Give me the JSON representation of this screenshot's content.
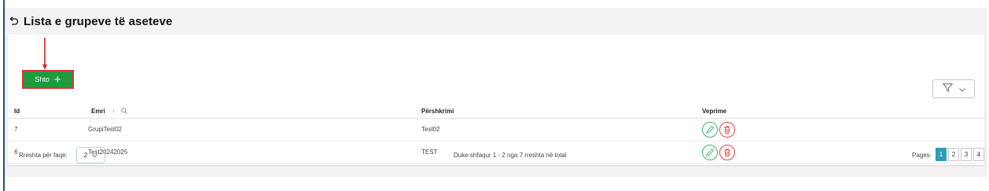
{
  "header": {
    "title": "Lista e grupeve të aseteve",
    "back_icon": "back-arrow-icon"
  },
  "toolbar": {
    "add_label": "Shto",
    "add_icon": "plus-icon",
    "filter_icon": "filter-icon",
    "filter_dropdown_icon": "chevron-down-icon"
  },
  "table": {
    "columns": {
      "id": "Id",
      "emri": "Emri",
      "pershkrimi": "Përshkrimi",
      "veprime": "Veprime"
    },
    "rows": [
      {
        "id": "7",
        "emri": "GrupiTest02",
        "pershkrimi": "Test02"
      },
      {
        "id": "6",
        "emri": "Test20242025",
        "pershkrimi": "TEST"
      }
    ]
  },
  "footer": {
    "rows_per_page_label": "Rreshta për faqe:",
    "rows_per_page_value": "2",
    "summary": "Duke shfaqur 1 - 2 nga 7 rreshta në total",
    "pages_label": "Pages:",
    "pages": [
      "1",
      "2",
      "3",
      "4"
    ],
    "active_page": "1"
  },
  "colors": {
    "accent_green": "#1f9a3c",
    "highlight_red": "#e23232",
    "page_active": "#2d9eb6",
    "edit_green": "#3fb56b",
    "delete_red": "#e04848"
  }
}
